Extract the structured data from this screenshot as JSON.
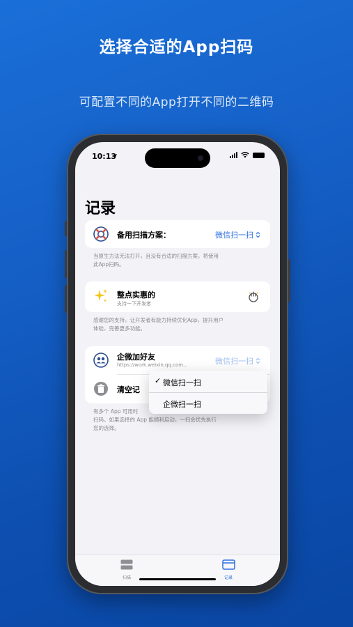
{
  "promo": {
    "headline": "选择合适的App扫码",
    "subline": "可配置不同的App打开不同的二维码"
  },
  "status_bar": {
    "time": "10:13"
  },
  "page": {
    "title": "记录"
  },
  "backup_scan": {
    "label": "备用扫描方案：",
    "value": "微信扫一扫",
    "footnote_line1": "当原生方法无法打开，且没有合适的扫描方案，将使用",
    "footnote_line2": "此App扫码。"
  },
  "support": {
    "title": "整点实惠的",
    "subtitle": "支持一下开发者",
    "footnote_line1": "感谢您的支持，让开发者有能力持续优化App，提升用户",
    "footnote_line2": "体验，完善更多功能。"
  },
  "record": {
    "title": "企微加好友",
    "url": "https://work.weixin.qq.com...",
    "value": "微信扫一扫",
    "clear_label": "清空记",
    "footnote_line1": "有多个 App 可用时",
    "footnote_line2": "扫码。如果选择的 App 能顺利启动，一扫会优先执行",
    "footnote_line3": "您的选择。"
  },
  "menu": {
    "options": [
      {
        "label": "微信扫一扫",
        "checked": true,
        "check_mark": "✓"
      },
      {
        "label": "企微扫一扫",
        "checked": false
      }
    ]
  },
  "tabs": [
    {
      "label": "扫描",
      "icon": "scan-icon"
    },
    {
      "label": "记录",
      "icon": "record-icon",
      "active": true
    }
  ],
  "colors": {
    "accent": "#2d6fe0",
    "background": "#1560c7"
  }
}
